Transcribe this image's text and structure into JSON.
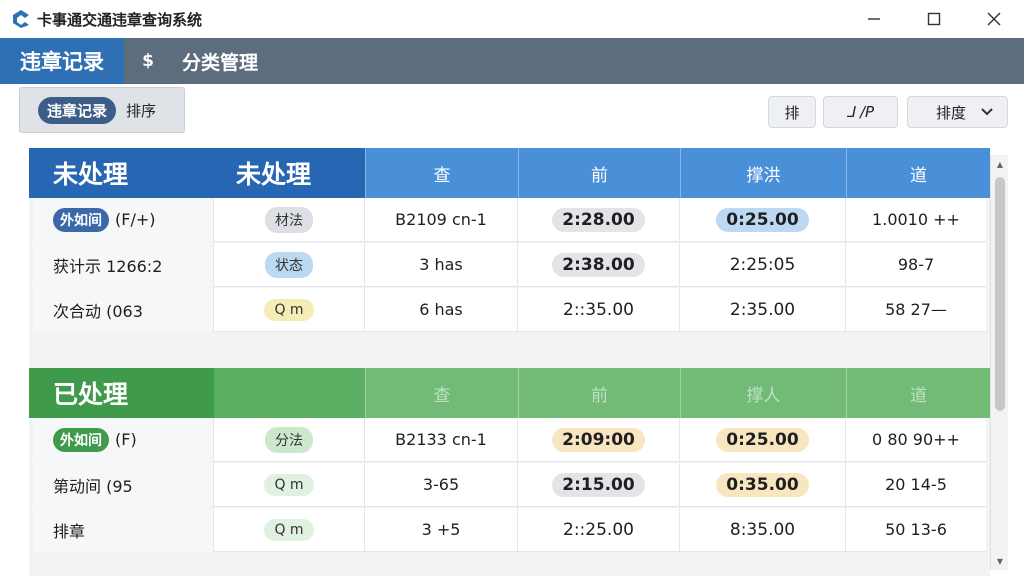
{
  "window": {
    "title": "卡事通交通违章查询系统"
  },
  "nav": {
    "active": "违章记录",
    "icon_text": "$",
    "item": "分类管理"
  },
  "toolbar": {
    "filter_active": "违章记录",
    "filter_other": "排序",
    "btn1": "排",
    "btn2": "⅃ /P",
    "btn3": "排度"
  },
  "sections": {
    "pending": {
      "title1": "未处理",
      "title2": "未处理",
      "cols": [
        "查",
        "前",
        "撑洪",
        "道"
      ],
      "rows": [
        {
          "pill": "外如间",
          "id": "(F/+)",
          "tag": "材法",
          "col2": "B2109 cn-1",
          "col3": "2:28.00",
          "col4": "0:25.00",
          "col5": "1.0010 ++"
        },
        {
          "pill": "",
          "id": "获计示 1266:2",
          "tag": "状态",
          "col2": "3 has",
          "col3": "2:38.00",
          "col4": "2:25:05",
          "col5": "98-7"
        },
        {
          "pill": "",
          "id": "次合动 (063",
          "tag": "Q m",
          "col2": "6 has",
          "col3": "2::35.00",
          "col4": "2:35.00",
          "col5": "58 27—"
        }
      ]
    },
    "done": {
      "title1": "已处理",
      "title2": "",
      "cols": [
        "查",
        "前",
        "撑人",
        "道"
      ],
      "rows": [
        {
          "pill": "外如间",
          "id": "(F)",
          "tag": "分法",
          "col2": "B2133 cn-1",
          "col3": "2:09:00",
          "col4": "0:25.00",
          "col5": "0 80 90++"
        },
        {
          "pill": "",
          "id": "第动间 (95",
          "tag": "Q m",
          "col2": "3-65",
          "col3": "2:15.00",
          "col4": "0:35.00",
          "col5": "20 14-5"
        },
        {
          "pill": "",
          "id": "排章",
          "tag": "Q m",
          "col2": "3 +5",
          "col3": "2::25.00",
          "col4": "8:35.00",
          "col5": "50 13-6"
        }
      ]
    }
  }
}
